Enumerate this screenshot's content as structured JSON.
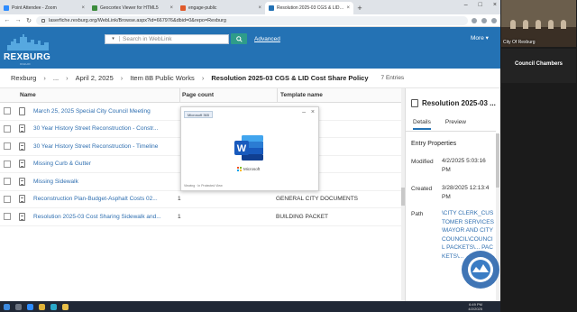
{
  "browser": {
    "tabs": [
      {
        "title": "Point Attendee - Zoom",
        "color": "#2d8cff"
      },
      {
        "title": "Geocortex Viewer for HTML5",
        "color": "#3c8c3c"
      },
      {
        "title": "engage-public",
        "color": "#e05a2b"
      },
      {
        "title": "Resolution 2025-03 CGS & LID Cost",
        "color": "#2472b4"
      }
    ],
    "url": "laserfiche.rexburg.org/WebLink/Browse.aspx?id=667976&dbid=0&repo=Rexburg"
  },
  "header": {
    "logo_text": "REXBURG",
    "logo_sub": "IDAHO",
    "search_placeholder": "Search in WebLink",
    "advanced_label": "Advanced",
    "more_label": "More"
  },
  "breadcrumb": {
    "items": [
      "Rexburg",
      "...",
      "April 2, 2025",
      "Item 8B Public Works"
    ],
    "current": "Resolution 2025-03 CGS & LID Cost Share Policy",
    "entries": "7 Entries"
  },
  "table": {
    "headers": {
      "name": "Name",
      "pages": "Page count",
      "template": "Template name"
    },
    "rows": [
      {
        "name": "March 25, 2025 Special City Council Meeting",
        "pages": "",
        "template": "",
        "icon": "folder"
      },
      {
        "name": "30 Year History Street Reconstruction - Constr...",
        "pages": "",
        "template": "",
        "icon": "doc"
      },
      {
        "name": "30 Year History Street Reconstruction - Timeline",
        "pages": "",
        "template": "",
        "icon": "doc"
      },
      {
        "name": "Missing Curb & Gutter",
        "pages": "",
        "template": "",
        "icon": "doc"
      },
      {
        "name": "Missing Sidewalk",
        "pages": "",
        "template": "",
        "icon": "doc"
      },
      {
        "name": "Reconstruction Plan-Budget-Asphalt Costs 02...",
        "pages": "1",
        "template": "GENERAL CITY DOCUMENTS",
        "icon": "doc"
      },
      {
        "name": "Resolution 2025-03 Cost Sharing Sidewalk and...",
        "pages": "1",
        "template": "BUILDING PACKET",
        "icon": "doc"
      }
    ]
  },
  "preview": {
    "tab_label": "Microsoft 365",
    "brand": "Microsoft",
    "footer": "Viewing · In Protected View"
  },
  "details": {
    "title": "Resolution 2025-03 ...",
    "tabs": [
      "Details",
      "Preview"
    ],
    "section": "Entry Properties",
    "modified_label": "Modified",
    "modified_value": "4/2/2025 5:03:16 PM",
    "created_label": "Created",
    "created_value": "3/28/2025 12:13:4 PM",
    "path_label": "Path",
    "path_value": "\\CITY CLERK_CUSTOMER SERVICES\\MAYOR AND CITY COUNCIL\\COUNCIL PACKETS\\... PACKETS\\..."
  },
  "taskbar": {
    "time": "6:49 PM",
    "date": "4/2/2025"
  },
  "zoom": {
    "video_caption": "City Of Rexburg",
    "participant_name": "Council Chambers"
  }
}
